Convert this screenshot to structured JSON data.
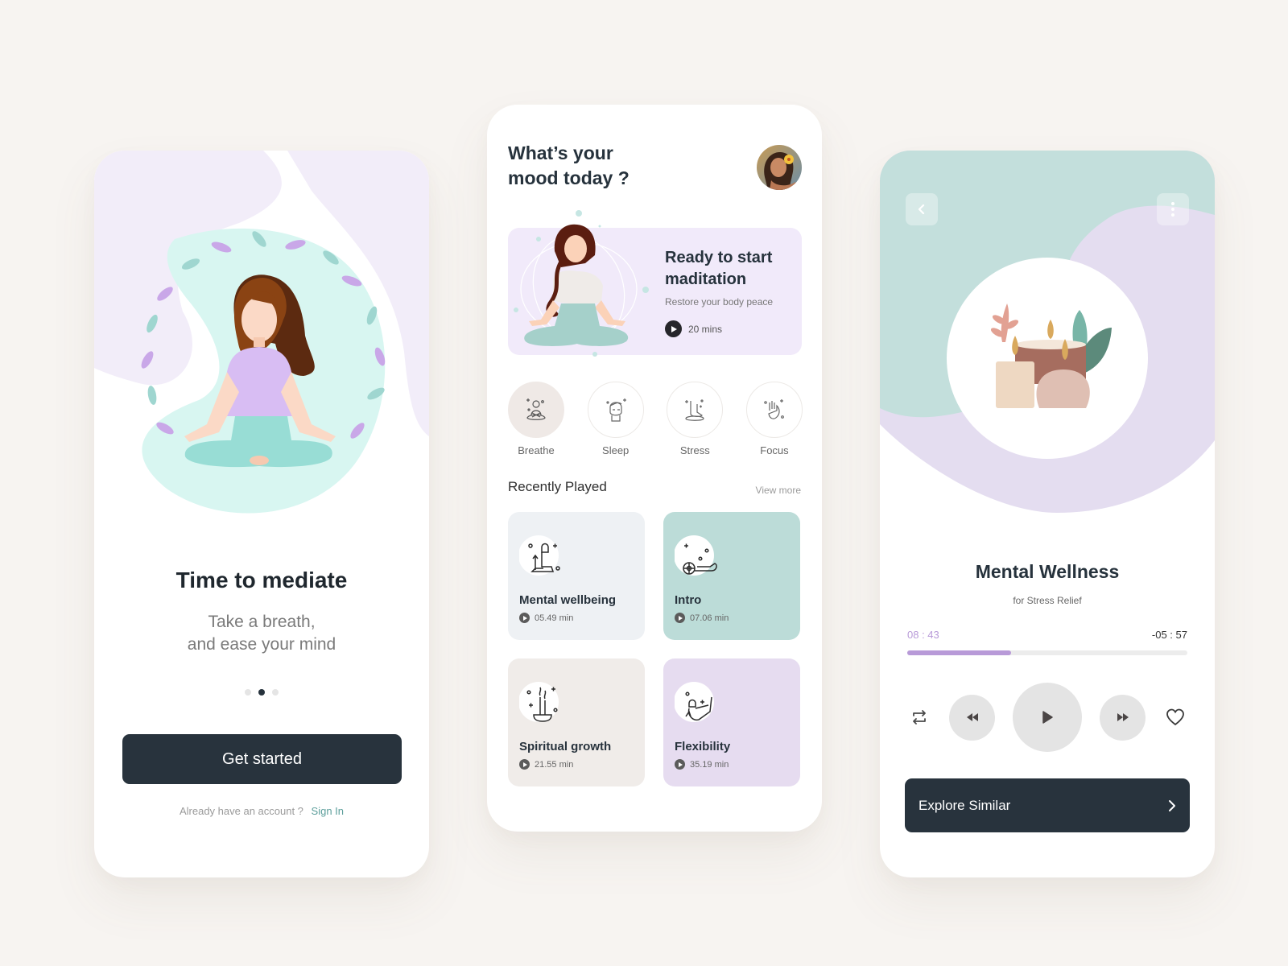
{
  "onboarding": {
    "title": "Time to mediate",
    "subtitle_line1": "Take a breath,",
    "subtitle_line2": "and ease your mind",
    "pagination": {
      "total": 3,
      "active_index": 1
    },
    "cta_label": "Get started",
    "account_prompt": "Already have an account ?",
    "signin_label": "Sign In"
  },
  "home": {
    "greeting_line1": "What’s your",
    "greeting_line2": "mood today ?",
    "banner": {
      "title_line1": "Ready to start",
      "title_line2": "maditation",
      "subtitle": "Restore your body peace",
      "duration": "20 mins"
    },
    "moods": [
      {
        "label": "Breathe",
        "icon": "meditating-person-icon",
        "active": true
      },
      {
        "label": "Sleep",
        "icon": "sleeping-face-icon",
        "active": false
      },
      {
        "label": "Stress",
        "icon": "stress-foot-icon",
        "active": false
      },
      {
        "label": "Focus",
        "icon": "focus-hand-icon",
        "active": false
      }
    ],
    "recent_title": "Recently Played",
    "view_more_label": "View more",
    "recent": [
      {
        "name": "Mental wellbeing",
        "duration": "05.49 min",
        "icon": "seated-person-icon",
        "color": "#eef1f4"
      },
      {
        "name": "Intro",
        "duration": "07.06 min",
        "icon": "lying-person-icon",
        "color": "#bcdcd8"
      },
      {
        "name": "Spiritual growth",
        "duration": "21.55 min",
        "icon": "incense-icon",
        "color": "#f0ece9"
      },
      {
        "name": "Flexibility",
        "duration": "35.19 min",
        "icon": "stretching-person-icon",
        "color": "#e6dcf0"
      }
    ]
  },
  "player": {
    "title": "Mental Wellness",
    "subtitle": "for Stress Relief",
    "elapsed": "08 : 43",
    "remaining": "-05 : 57",
    "progress_fraction": 0.37,
    "explore_label": "Explore Similar"
  },
  "colors": {
    "background": "#f7f4f1",
    "dark": "#28333d",
    "accent_purple": "#b89ad8",
    "accent_teal": "#5d9f9c",
    "lavender": "#f1eafa",
    "mint": "#d5f4ef"
  }
}
